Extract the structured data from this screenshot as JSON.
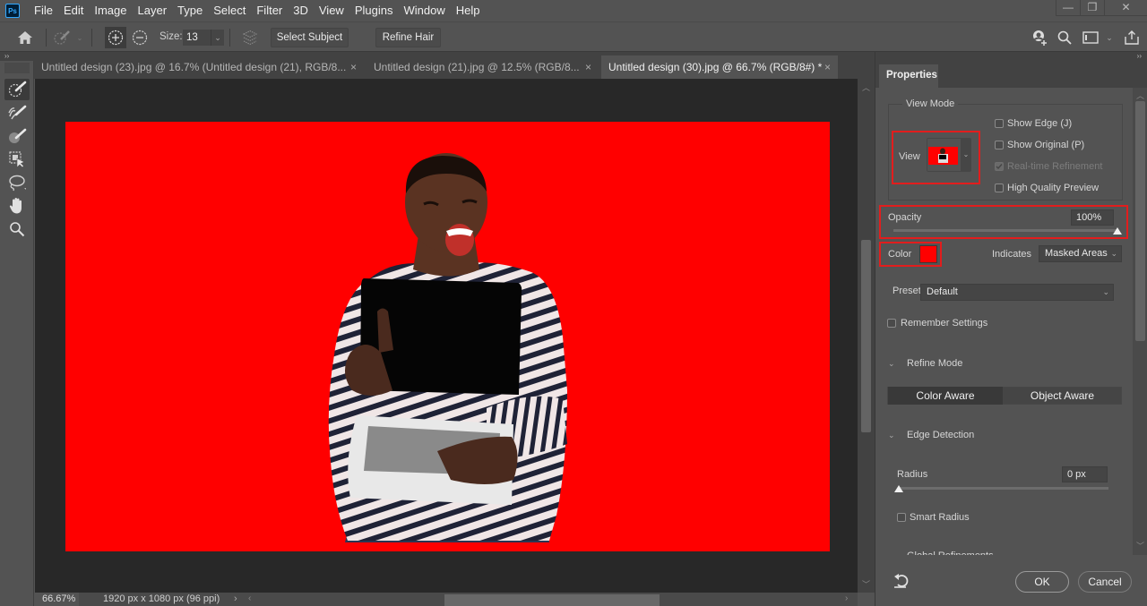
{
  "app": {
    "name": "Adobe Photoshop",
    "logo_text": "Ps",
    "menu": [
      "File",
      "Edit",
      "Image",
      "Layer",
      "Type",
      "Select",
      "Filter",
      "3D",
      "View",
      "Plugins",
      "Window",
      "Help"
    ],
    "window_controls": {
      "minimize": "—",
      "restore": "❐",
      "close": "✕"
    }
  },
  "options_bar": {
    "size_label": "Size:",
    "size_value": "13",
    "select_subject_label": "Select Subject",
    "refine_hair_label": "Refine Hair",
    "right_icons": [
      "share-user-icon",
      "search-icon",
      "workspace-icon",
      "share-icon"
    ]
  },
  "toolbar": {
    "collapse": "››",
    "tools": [
      {
        "name": "quick-selection-tool",
        "active": true
      },
      {
        "name": "refine-edge-brush-tool",
        "active": false
      },
      {
        "name": "brush-tool",
        "active": false
      },
      {
        "name": "object-selection-tool",
        "active": false
      },
      {
        "name": "lasso-tool",
        "active": false
      },
      {
        "name": "hand-tool",
        "active": false
      },
      {
        "name": "zoom-tool",
        "active": false
      }
    ]
  },
  "tabs": [
    {
      "label": "Untitled design (23).jpg @ 16.7% (Untitled design (21), RGB/8...",
      "active": false
    },
    {
      "label": "Untitled design (21).jpg @ 12.5% (RGB/8...",
      "active": false
    },
    {
      "label": "Untitled design (30).jpg @ 66.7% (RGB/8#) *",
      "active": true
    }
  ],
  "tab_close": "×",
  "status": {
    "zoom": "66.67%",
    "doc_info": "1920 px x 1080 px (96 ppi)",
    "arrow": "›"
  },
  "canvas": {
    "overlay_color": "#ff0000"
  },
  "properties": {
    "panel_tab": "Properties",
    "view_mode": {
      "title": "View Mode",
      "view_label": "View",
      "show_edge": {
        "label": "Show Edge (J)",
        "checked": false
      },
      "show_original": {
        "label": "Show Original (P)",
        "checked": false
      },
      "realtime_refinement": {
        "label": "Real-time Refinement",
        "checked": true,
        "disabled": true
      },
      "high_quality_preview": {
        "label": "High Quality Preview",
        "checked": false
      }
    },
    "opacity": {
      "label": "Opacity",
      "value": "100%",
      "fraction": 1.0
    },
    "color": {
      "label": "Color",
      "swatch": "#ff0000"
    },
    "indicates": {
      "label": "Indicates",
      "value": "Masked Areas"
    },
    "preset": {
      "label": "Preset",
      "value": "Default"
    },
    "remember_settings": {
      "label": "Remember Settings",
      "checked": false
    },
    "refine_mode": {
      "title": "Refine Mode",
      "options": [
        "Color Aware",
        "Object Aware"
      ],
      "selected": "Color Aware"
    },
    "edge_detection": {
      "title": "Edge Detection",
      "radius_label": "Radius",
      "radius_value": "0 px",
      "radius_fraction": 0.0,
      "smart_radius": {
        "label": "Smart Radius",
        "checked": false
      }
    },
    "clipped_section": "Global Refinements",
    "ok_label": "OK",
    "cancel_label": "Cancel"
  },
  "colors": {
    "highlight_box": "#e21d1d",
    "panel_bg": "#535353",
    "canvas_bg": "#282828"
  }
}
